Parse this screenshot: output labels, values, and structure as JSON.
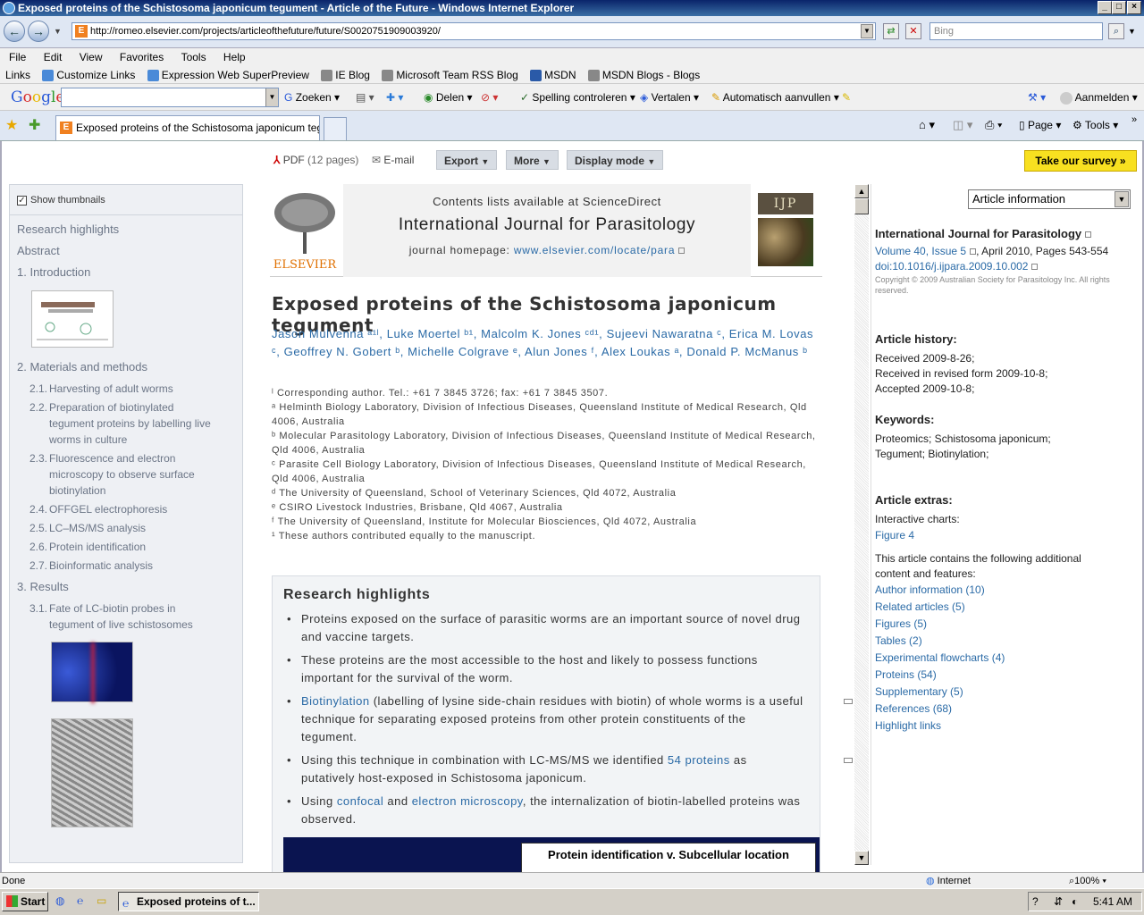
{
  "window": {
    "title": "Exposed proteins of the Schistosoma japonicum tegument - Article of the Future - Windows Internet Explorer"
  },
  "address": {
    "url": "http://romeo.elsevier.com/projects/articleofthefuture/future/S0020751909003920/",
    "search_placeholder": "Bing"
  },
  "menu": [
    "File",
    "Edit",
    "View",
    "Favorites",
    "Tools",
    "Help"
  ],
  "links": {
    "label": "Links",
    "items": [
      "Customize Links",
      "Expression Web SuperPreview",
      "IE Blog",
      "Microsoft Team RSS Blog",
      "MSDN",
      "MSDN Blogs - Blogs"
    ]
  },
  "google": {
    "logo": "Google",
    "items": [
      "Zoeken",
      "Delen",
      "Spelling controleren",
      "Vertalen",
      "Automatisch aanvullen"
    ],
    "signin": "Aanmelden"
  },
  "tabs": {
    "active": "Exposed proteins of the Schistosoma japonicum tegu...",
    "tools": [
      "Page",
      "Tools"
    ]
  },
  "toolbar": {
    "pdf": "PDF",
    "pdf_pages": "(12 pages)",
    "email": "E-mail",
    "export": "Export",
    "more": "More",
    "display": "Display mode",
    "survey": "Take our survey »"
  },
  "leftnav": {
    "show_thumbs": "Show thumbnails",
    "items": [
      {
        "type": "h",
        "text": "Research highlights"
      },
      {
        "type": "h",
        "text": "Abstract"
      },
      {
        "type": "h",
        "text": "1. Introduction"
      },
      {
        "type": "h",
        "text": "2. Materials and methods"
      },
      {
        "type": "s",
        "num": "2.1.",
        "text": "Harvesting of adult worms"
      },
      {
        "type": "s",
        "num": "2.2.",
        "text": "Preparation of biotinylated tegument proteins by labelling live worms in culture"
      },
      {
        "type": "s",
        "num": "2.3.",
        "text": "Fluorescence and electron microscopy to observe surface biotinylation"
      },
      {
        "type": "s",
        "num": "2.4.",
        "text": "OFFGEL electrophoresis"
      },
      {
        "type": "s",
        "num": "2.5.",
        "text": "LC–MS/MS analysis"
      },
      {
        "type": "s",
        "num": "2.6.",
        "text": "Protein identification"
      },
      {
        "type": "s",
        "num": "2.7.",
        "text": "Bioinformatic analysis"
      },
      {
        "type": "h",
        "text": "3. Results"
      },
      {
        "type": "s",
        "num": "3.1.",
        "text": "Fate of LC-biotin probes in tegument of live schistosomes"
      }
    ]
  },
  "journal": {
    "publisher": "ELSEVIER",
    "contents": "Contents lists available at ScienceDirect",
    "name": "International Journal for Parasitology",
    "homepage_label": "journal homepage:",
    "homepage": "www.elsevier.com/locate/para",
    "badge": "IJP"
  },
  "article": {
    "title": "Exposed proteins of the Schistosoma japonicum tegument",
    "authors": "Jason Mulvenna ᵃ¹ˡ, Luke Moertel ᵇ¹, Malcolm K. Jones ᶜᵈ¹, Sujeevi Nawaratna ᶜ, Erica M. Lovas ᶜ, Geoffrey N. Gobert ᵇ, Michelle Colgrave ᵉ, Alun Jones ᶠ, Alex Loukas ᵃ, Donald P. McManus ᵇ",
    "affiliations": [
      "ˡ Corresponding author. Tel.: +61 7 3845 3726; fax: +61 7 3845 3507.",
      "ᵃ Helminth Biology Laboratory, Division of Infectious Diseases, Queensland Institute of Medical Research, Qld 4006, Australia",
      "ᵇ Molecular Parasitology Laboratory, Division of Infectious Diseases, Queensland Institute of Medical Research, Qld 4006, Australia",
      "ᶜ Parasite Cell Biology Laboratory, Division of Infectious Diseases, Queensland Institute of Medical Research, Qld 4006, Australia",
      "ᵈ The University of Queensland, School of Veterinary Sciences, Qld 4072, Australia",
      "ᵉ CSIRO Livestock Industries, Brisbane, Qld 4067, Australia",
      "ᶠ The University of Queensland, Institute for Molecular Biosciences, Qld 4072, Australia",
      "¹ These authors contributed equally to the manuscript."
    ],
    "highlights_title": "Research highlights",
    "h1": "Proteins exposed on the surface of parasitic worms are an important source of novel drug and vaccine targets.",
    "h2": "These proteins are the most accessible to the host and likely to possess functions important for the survival of the worm.",
    "h3_link": "Biotinylation",
    "h3_rest": " (labelling of lysine side-chain residues with biotin) of whole worms is a useful technique for separating exposed proteins from other protein constituents of the tegument.",
    "h4_a": "Using this technique in combination with LC-MS/MS we identified ",
    "h4_link": "54 proteins",
    "h4_b": " as putatively host-exposed in Schistosoma japonicum.",
    "h5_a": "Using ",
    "h5_link1": "confocal",
    "h5_mid": " and ",
    "h5_link2": "electron microscopy",
    "h5_b": ", the internalization of biotin-labelled proteins was observed.",
    "graphic_caption": "Protein identification v. Subcellular location"
  },
  "rightpanel": {
    "select": "Article information",
    "journal": "International Journal for Parasitology",
    "volume": "Volume 40, Issue 5",
    "pages": ", April 2010, Pages 543-554",
    "doi": "doi:10.1016/j.ijpara.2009.10.002",
    "copyright": "Copyright © 2009 Australian Society for Parasitology Inc. All rights reserved.",
    "history_title": "Article history:",
    "history": [
      "Received 2009-8-26;",
      "Received in revised form 2009-10-8;",
      "Accepted 2009-10-8;"
    ],
    "keywords_title": "Keywords:",
    "keywords": "Proteomics; Schistosoma japonicum; Tegument; Biotinylation;",
    "extras_title": "Article extras:",
    "interactive": "Interactive charts:",
    "figure": "Figure 4",
    "contains": "This article contains the following additional content and features:",
    "features": [
      "Author information (10)",
      "Related articles (5)",
      "Figures (5)",
      "Tables (2)",
      "Experimental flowcharts (4)",
      "Proteins (54)",
      "Supplementary (5)",
      "References (68)",
      "Highlight links"
    ]
  },
  "status": {
    "text": "Done",
    "zone": "Internet",
    "zoom": "100%"
  },
  "taskbar": {
    "start": "Start",
    "task": "Exposed proteins of t...",
    "time": "5:41 AM"
  }
}
